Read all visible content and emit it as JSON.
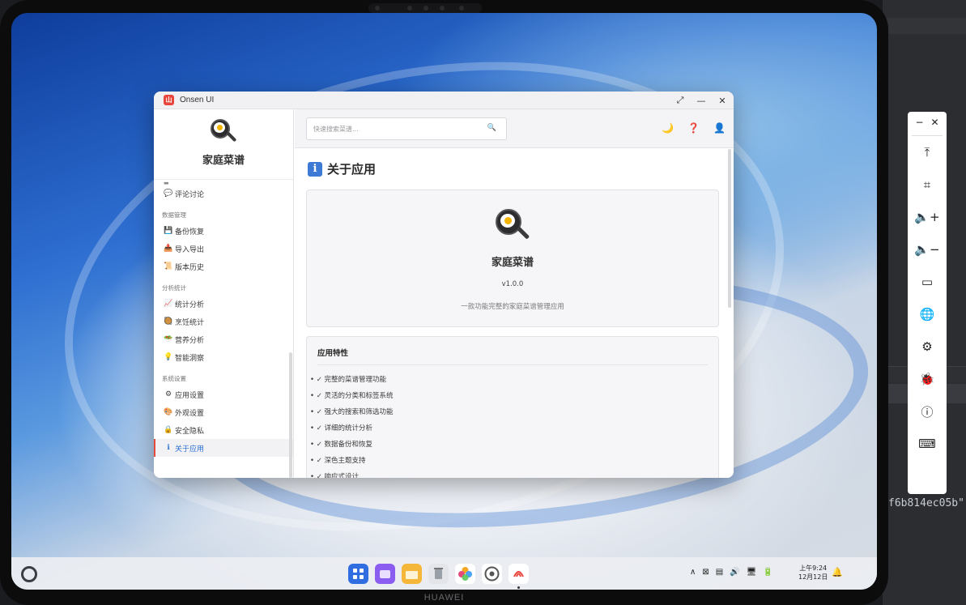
{
  "device": {
    "brand": "HUAWEI"
  },
  "ide": {
    "code_fragment": "f6b814ec05b\""
  },
  "window": {
    "title": "Onsen UI",
    "logo_text": "山",
    "controls": {
      "restore": "⤢",
      "minimize": "—",
      "close": "✕"
    }
  },
  "sidebar": {
    "app_name": "家庭菜谱",
    "groups": [
      {
        "items": [
          {
            "icon": "💬",
            "label": "评论讨论"
          }
        ]
      },
      {
        "label": "数据管理",
        "items": [
          {
            "icon": "💾",
            "label": "备份恢复"
          },
          {
            "icon": "📥",
            "label": "导入导出"
          },
          {
            "icon": "📜",
            "label": "版本历史"
          }
        ]
      },
      {
        "label": "分析统计",
        "items": [
          {
            "icon": "📈",
            "label": "统计分析"
          },
          {
            "icon": "🥘",
            "label": "烹饪统计"
          },
          {
            "icon": "🥗",
            "label": "营养分析"
          },
          {
            "icon": "💡",
            "label": "智能洞察"
          }
        ]
      },
      {
        "label": "系统设置",
        "items": [
          {
            "icon": "⚙",
            "label": "应用设置"
          },
          {
            "icon": "🎨",
            "label": "外观设置"
          },
          {
            "icon": "🔒",
            "label": "安全隐私"
          },
          {
            "icon": "ℹ",
            "label": "关于应用",
            "active": true
          }
        ]
      }
    ]
  },
  "topbar": {
    "search_placeholder": "快速搜索菜谱...",
    "search_icon": "🔍",
    "theme_icon": "🌙",
    "help_icon": "❓",
    "user_icon": "👤"
  },
  "about": {
    "page_title": "关于应用",
    "info_badge": "i",
    "app_name": "家庭菜谱",
    "version": "v1.0.0",
    "description": "一款功能完整的家庭菜谱管理应用",
    "features_title": "应用特性",
    "features": [
      "• ✓ 完整的菜谱管理功能",
      "• ✓ 灵活的分类和标签系统",
      "• ✓ 强大的搜索和筛选功能",
      "• ✓ 详细的统计分析",
      "• ✓ 数据备份和恢复",
      "• ✓ 深色主题支持",
      "• ✓ 响应式设计"
    ]
  },
  "taskbar": {
    "apps": [
      {
        "name": "app-grid",
        "color": "#2f6de0"
      },
      {
        "name": "multitask",
        "color": "#8a5cf0"
      },
      {
        "name": "notes",
        "color": "#f4b73a"
      },
      {
        "name": "trash",
        "color": "#e3e5e8"
      },
      {
        "name": "gallery",
        "color": "#ffffff"
      },
      {
        "name": "settings",
        "color": "#ffffff"
      },
      {
        "name": "onsen-app",
        "color": "#ffffff",
        "label": "Onsen UI"
      }
    ],
    "tray": [
      "∧",
      "⊠",
      "▤",
      "🔊",
      "🖥",
      "🔋"
    ],
    "time": "上午9:24",
    "date": "12月12日",
    "bell": "🔔"
  },
  "emulator_toolbar": {
    "top": [
      "−",
      "✕"
    ],
    "buttons": [
      "⤒",
      "⌗",
      "🔈+",
      "🔈−",
      "▭",
      "🌐",
      "⚙",
      "🐞",
      "ⓘ",
      "⌨"
    ]
  }
}
